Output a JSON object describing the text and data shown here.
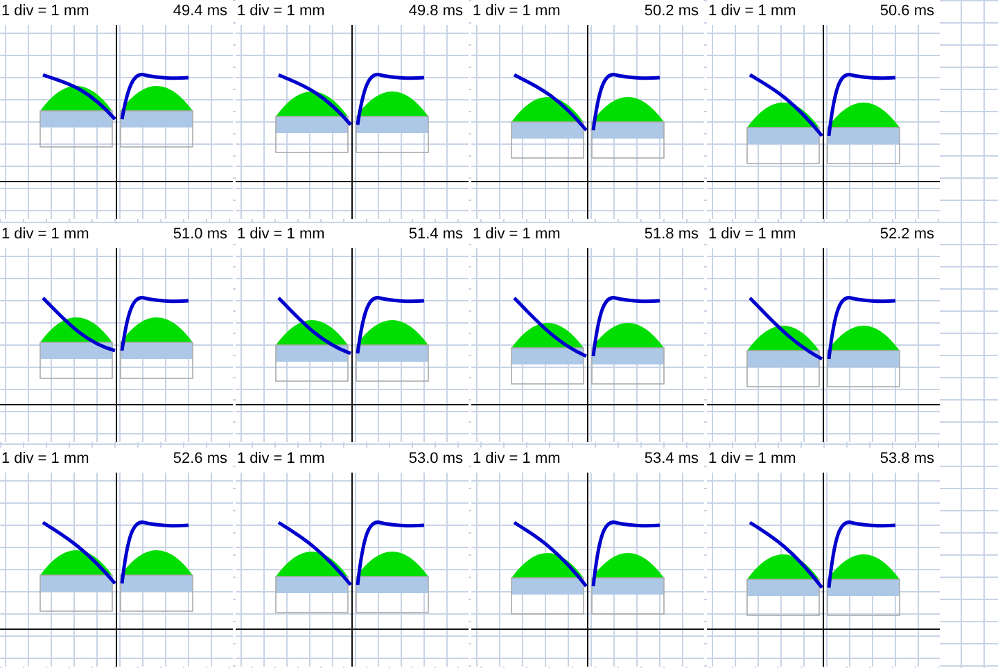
{
  "panels": [
    {
      "scale": "1 div = 1 mm",
      "time": "49.4 ms"
    },
    {
      "scale": "1 div = 1 mm",
      "time": "49.8 ms"
    },
    {
      "scale": "1 div = 1 mm",
      "time": "50.2 ms"
    },
    {
      "scale": "1 div = 1 mm",
      "time": "50.6 ms"
    },
    {
      "scale": "1 div = 1 mm",
      "time": "51.0 ms"
    },
    {
      "scale": "1 div = 1 mm",
      "time": "51.4 ms"
    },
    {
      "scale": "1 div = 1 mm",
      "time": "51.8 ms"
    },
    {
      "scale": "1 div = 1 mm",
      "time": "52.2 ms"
    },
    {
      "scale": "1 div = 1 mm",
      "time": "52.6 ms"
    },
    {
      "scale": "1 div = 1 mm",
      "time": "53.0 ms"
    },
    {
      "scale": "1 div = 1 mm",
      "time": "53.4 ms"
    },
    {
      "scale": "1 div = 1 mm",
      "time": "53.8 ms"
    }
  ]
}
